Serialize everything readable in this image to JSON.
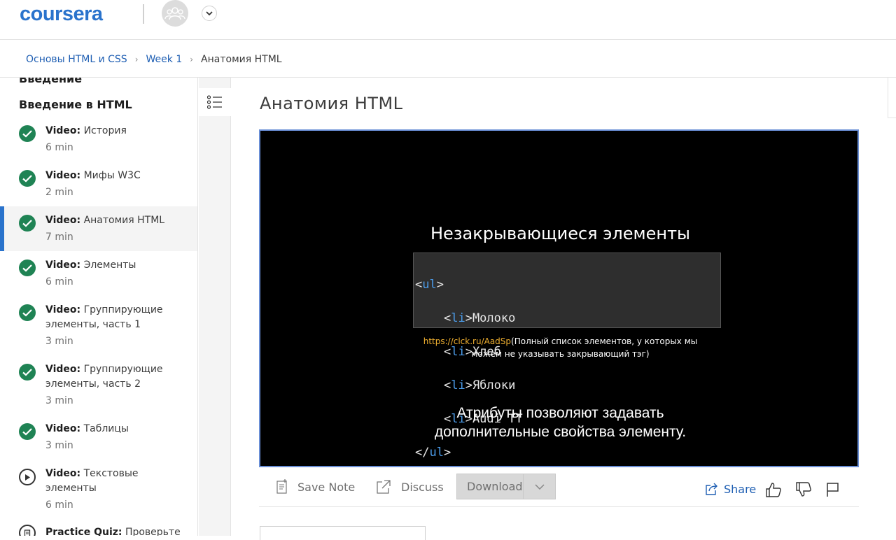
{
  "header": {
    "logo_text": "coursera",
    "brand_color": "#2a73cc"
  },
  "breadcrumb": {
    "course": "Основы HTML и CSS",
    "week": "Week 1",
    "current": "Анатомия HTML"
  },
  "sidebar": {
    "prev_section": "Введение",
    "section_title": "Введение в HTML",
    "items": [
      {
        "type": "Video:",
        "name": "История",
        "duration": "6 min",
        "status": "completed"
      },
      {
        "type": "Video:",
        "name": "Мифы W3C",
        "duration": "2 min",
        "status": "completed"
      },
      {
        "type": "Video:",
        "name": "Анатомия HTML",
        "duration": "7 min",
        "status": "completed",
        "active": true
      },
      {
        "type": "Video:",
        "name": "Элементы",
        "duration": "6 min",
        "status": "completed"
      },
      {
        "type": "Video:",
        "name": "Группирующие элементы, часть 1",
        "duration": "3 min",
        "status": "completed"
      },
      {
        "type": "Video:",
        "name": "Группирующие элементы, часть 2",
        "duration": "3 min",
        "status": "completed"
      },
      {
        "type": "Video:",
        "name": "Таблицы",
        "duration": "3 min",
        "status": "completed"
      },
      {
        "type": "Video:",
        "name": "Текстовые элементы",
        "duration": "6 min",
        "status": "not-started"
      },
      {
        "type": "Practice Quiz:",
        "name": "Проверьте",
        "duration": "",
        "status": "quiz"
      }
    ]
  },
  "main": {
    "title": "Анатомия HTML",
    "video": {
      "slide_title": "Незакрывающиеся элементы",
      "code_lines": [
        {
          "open": "<",
          "tag": "ul",
          "close": ">",
          "text": "",
          "indent": ""
        },
        {
          "open": "<",
          "tag": "li",
          "close": ">",
          "text": "Молоко",
          "indent": "    "
        },
        {
          "open": "<",
          "tag": "li",
          "close": ">",
          "text": "Хлеб",
          "indent": "    "
        },
        {
          "open": "<",
          "tag": "li",
          "close": ">",
          "text": "Яблоки",
          "indent": "    "
        },
        {
          "open": "<",
          "tag": "li",
          "close": ">",
          "text": "Audi TT",
          "indent": "    "
        },
        {
          "open": "</",
          "tag": "ul",
          "close": ">",
          "text": "",
          "indent": ""
        }
      ],
      "link_url": "https://clck.ru/AadSp",
      "link_note_1": "(Полный список элементов, у которых мы",
      "link_note_2": "можем не указывать закрывающий тэг)",
      "caption_1": "Атрибуты позволяют задавать",
      "caption_2": "дополнительные свойства элементу."
    },
    "actions": {
      "save_note": "Save Note",
      "discuss": "Discuss",
      "download": "Download",
      "share": "Share"
    }
  }
}
